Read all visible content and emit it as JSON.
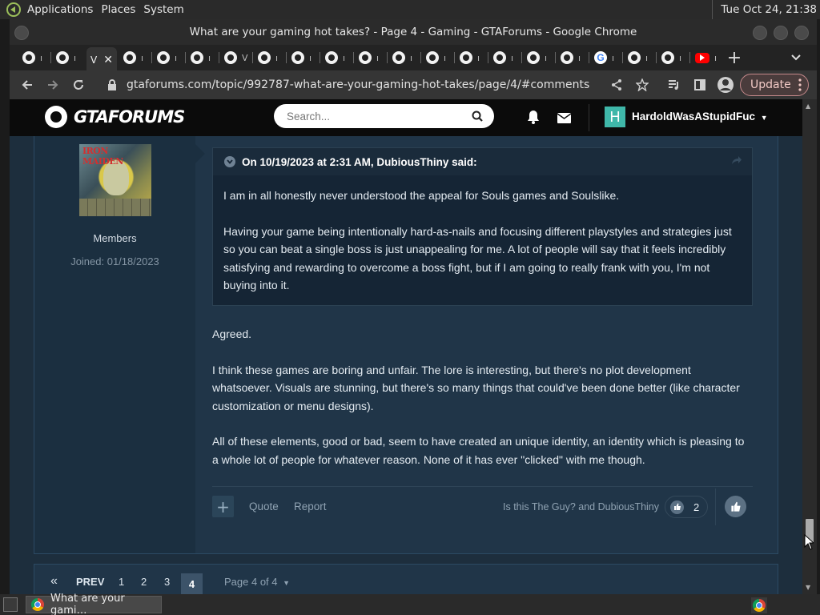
{
  "os_panel": {
    "menus": [
      "Applications",
      "Places",
      "System"
    ],
    "clock": "Tue Oct 24, 21:38"
  },
  "window": {
    "title": "What are your gaming hot takes? - Page 4 - Gaming - GTAForums - Google Chrome"
  },
  "tabs": {
    "labels": [
      "ı",
      "ı",
      "ı",
      "ı",
      "ı",
      "ı",
      "V",
      "ı",
      "ı",
      "ı",
      "ı",
      "ı",
      "ı",
      "ı",
      "ı",
      "ı",
      "ı",
      "ı",
      "ı",
      "ı",
      "ı",
      "ı"
    ],
    "active_label": "V"
  },
  "toolbar": {
    "url": "gtaforums.com/topic/992787-what-are-your-gaming-hot-takes/page/4/#comments",
    "update_label": "Update"
  },
  "site": {
    "logo_text": "GTAFORUMS",
    "search_placeholder": "Search...",
    "user_initial": "H",
    "username": "HardoldWasAStupidFuc"
  },
  "post": {
    "author_group": "Members",
    "joined": "Joined: 01/18/2023",
    "avatar_text": "IRON MAIDEN",
    "quote_header": "On 10/19/2023 at 2:31 AM, DubiousThiny said:",
    "quote_paragraphs": [
      "I am in all honestly never understood the appeal for Souls games and Soulslike.",
      "Having your game being intentionally hard-as-nails and focusing different playstyles and strategies just so you can beat a single boss is just unappealing for me. A lot of people will say that it feels incredibly satisfying and rewarding to overcome a boss fight, but if I am going to really frank with you, I'm not buying into it."
    ],
    "reply_paragraphs": [
      "Agreed.",
      "I think these games are boring and unfair. The lore is interesting, but there's no plot development whatsoever. Visuals are stunning, but there's so many things that could've been done better (like character customization or menu designs).",
      "All of these elements, good or bad, seem to have created an unique identity, an identity which is pleasing to a whole lot of people for whatever reason. None of it has ever \"clicked\" with me though."
    ],
    "quote_label": "Quote",
    "report_label": "Report",
    "likers": "Is this The Guy? and DubiousThiny",
    "reaction_count": "2"
  },
  "pagination": {
    "prev": "PREV",
    "pages": [
      "1",
      "2",
      "3"
    ],
    "current": "4",
    "jump": "Page 4 of 4"
  },
  "taskbar": {
    "task_label": "What are your gami…"
  }
}
